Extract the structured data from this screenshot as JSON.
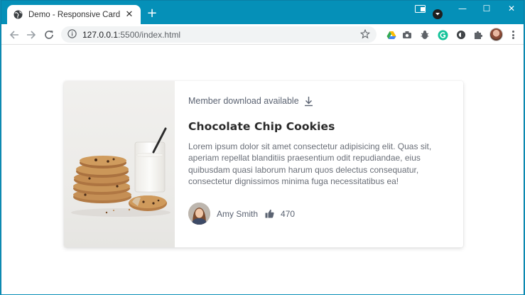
{
  "browser": {
    "tab_title": "Demo - Responsive Card Compo",
    "tab_close": "✕",
    "new_tab": "+",
    "url_host": "127.0.0.1",
    "url_rest": ":5500/index.html",
    "window_controls": {
      "minimize": "—",
      "maximize": "☐",
      "close": "✕"
    },
    "accent_color": "#0590b8"
  },
  "card": {
    "member_text": "Member download available",
    "title": "Chocolate Chip Cookies",
    "description": "Lorem ipsum dolor sit amet consectetur adipisicing elit. Quas sit, aperiam repellat blanditiis praesentium odit repudiandae, eius quibusdam quasi laborum harum quos delectus consequatur, consectetur dignissimos minima fuga necessitatibus ea!",
    "author_name": "Amy Smith",
    "likes": "470",
    "image_subject": "cookies-and-milk-photo",
    "icons": [
      "download-icon",
      "thumbs-up-icon"
    ]
  }
}
